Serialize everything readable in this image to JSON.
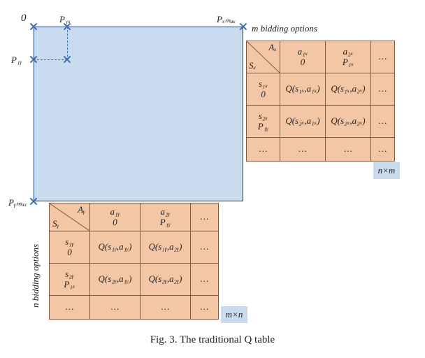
{
  "caption": "Fig. 3. The traditional Q table",
  "ellipsis": "…",
  "axes": {
    "origin": "0",
    "P1x": "P₁ₓ",
    "Pxmax": "Pₓₘₐₓ",
    "P1y": "P₁ᵧ",
    "Pymax": "Pᵧₘₐₓ",
    "m_options": "m bidding options",
    "n_options": "n bidding options"
  },
  "tableX": {
    "header": {
      "top": "Aₓ",
      "left": "Sₓ"
    },
    "cols": [
      {
        "l1": "a₁ₓ",
        "l2": "0"
      },
      {
        "l1": "a₂ₓ",
        "l2": "P₁ₓ"
      }
    ],
    "rows": [
      {
        "l1": "s₁ₓ",
        "l2": "0"
      },
      {
        "l1": "s₂ₓ",
        "l2": "P₁ᵧ"
      }
    ],
    "cells": [
      [
        "Q(s₁ₓ,a₁ₓ)",
        "Q(s₁ₓ,a₂ₓ)"
      ],
      [
        "Q(s₂ₓ,a₁ₓ)",
        "Q(s₂ₓ,a₂ₓ)"
      ]
    ],
    "size": "n×m"
  },
  "tableY": {
    "header": {
      "top": "Aᵧ",
      "left": "Sᵧ"
    },
    "cols": [
      {
        "l1": "a₁ᵧ",
        "l2": "0"
      },
      {
        "l1": "a₂ᵧ",
        "l2": "P₁ᵧ"
      }
    ],
    "rows": [
      {
        "l1": "s₁ᵧ",
        "l2": "0"
      },
      {
        "l1": "s₂ᵧ",
        "l2": "P₁ₓ"
      }
    ],
    "cells": [
      [
        "Q(s₁ᵧ,a₁ᵧ)",
        "Q(s₁ᵧ,a₂ᵧ)"
      ],
      [
        "Q(s₂ᵧ,a₁ᵧ)",
        "Q(s₂ᵧ,a₂ᵧ)"
      ]
    ],
    "size": "m×n"
  }
}
